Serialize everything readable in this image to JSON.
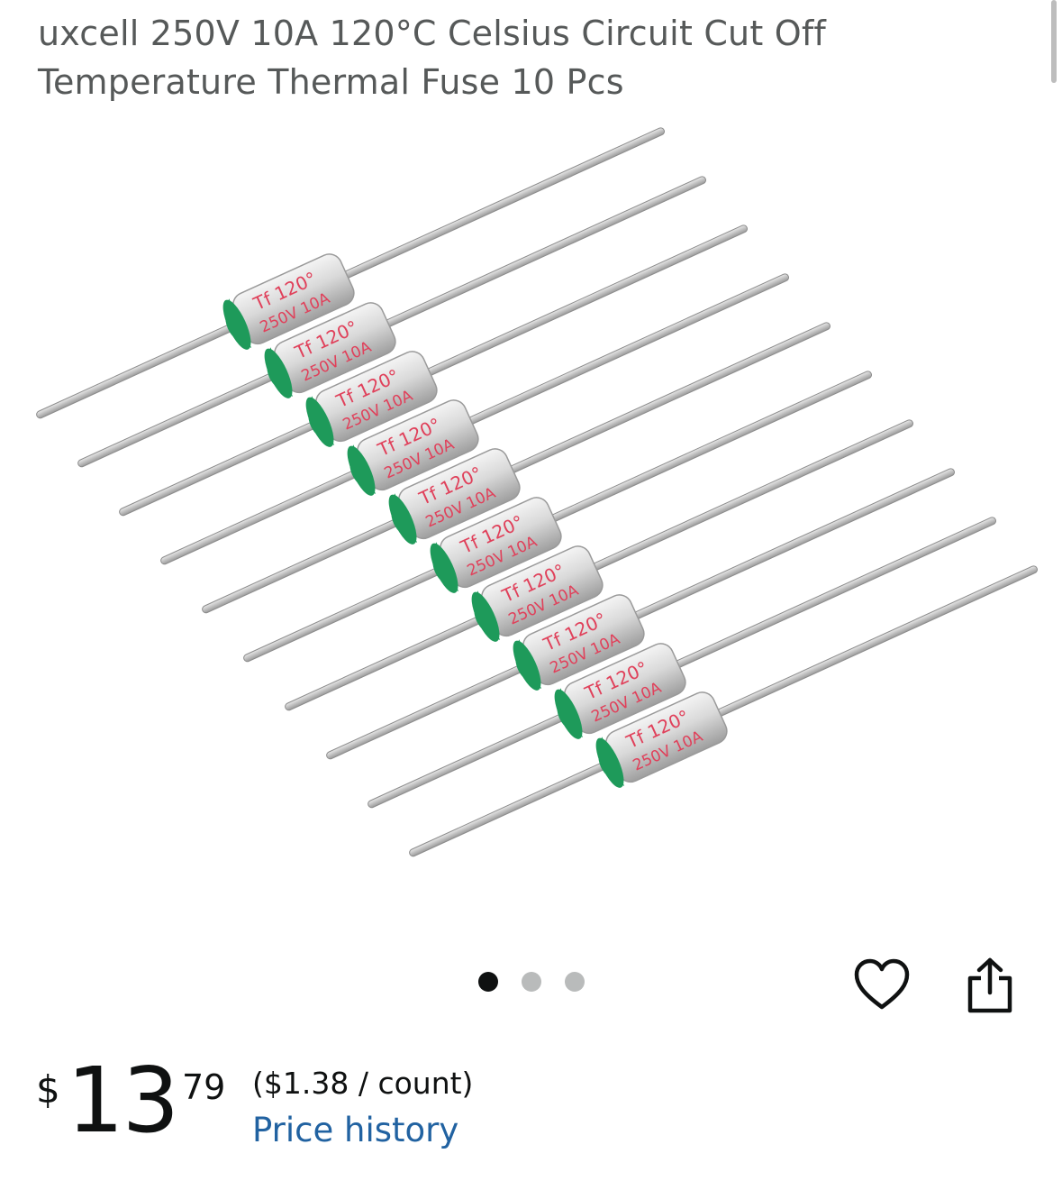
{
  "product": {
    "title": "uxcell 250V 10A 120°C Celsius Circuit Cut Off Temperature Thermal Fuse 10 Pcs",
    "image_alt_icon": "thermal-fuse-product-image",
    "fuse_marking_top": "Tf 120",
    "fuse_marking_bottom": "250V 10A",
    "fuse_count": 10
  },
  "carousel": {
    "total_images": 3,
    "active_index": 0
  },
  "actions": {
    "wishlist_icon": "heart-icon",
    "share_icon": "share-icon"
  },
  "pricing": {
    "symbol": "$",
    "whole": "13",
    "fraction": "79",
    "unit_price": "($1.38 / count)",
    "history_link": "Price history"
  },
  "colors": {
    "price_link": "#2162a1",
    "title": "#565959",
    "fuse_cap": "#1e9a5a",
    "fuse_text": "#e0405a"
  }
}
